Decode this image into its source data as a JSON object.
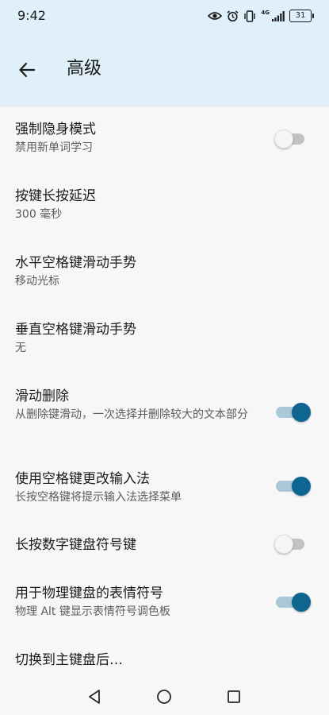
{
  "status": {
    "time": "9:42",
    "battery": "31",
    "network": "4G"
  },
  "appbar": {
    "title": "高级",
    "back_icon": "arrow-back-icon"
  },
  "items": [
    {
      "title": "强制隐身模式",
      "subtitle": "禁用新单词学习",
      "toggle": false
    },
    {
      "title": "按键长按延迟",
      "subtitle": "300 毫秒"
    },
    {
      "title": "水平空格键滑动手势",
      "subtitle": "移动光标"
    },
    {
      "title": "垂直空格键滑动手势",
      "subtitle": "无"
    },
    {
      "title": "滑动删除",
      "subtitle": "从删除键滑动，一次选择并删除较大的文本部分",
      "toggle": true
    },
    {
      "title": "使用空格键更改输入法",
      "subtitle": "长按空格键将提示输入法选择菜单",
      "toggle": true
    },
    {
      "title": "长按数字键盘符号键",
      "toggle": false
    },
    {
      "title": "用于物理键盘的表情符号",
      "subtitle": "物理 Alt 键显示表情符号调色板",
      "toggle": true
    },
    {
      "title": "切换到主键盘后…"
    }
  ],
  "colors": {
    "appbar_bg": "#dff0fb",
    "accent": "#0e6690",
    "background": "#f7f7f7"
  }
}
